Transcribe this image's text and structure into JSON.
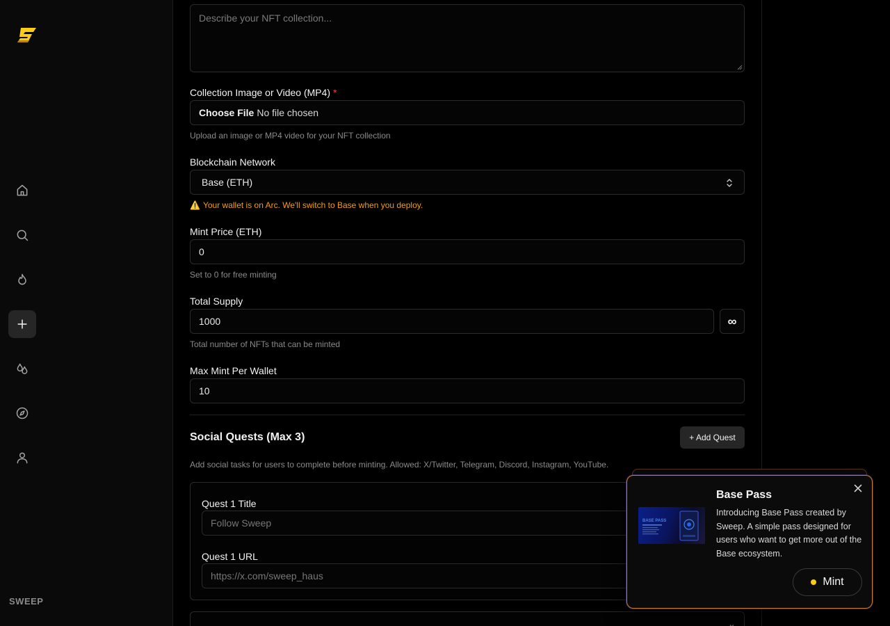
{
  "brand": {
    "name": "SWEEP",
    "accent": "#facc15"
  },
  "sidebar": {
    "items": [
      {
        "icon": "home-icon",
        "active": false
      },
      {
        "icon": "search-icon",
        "active": false
      },
      {
        "icon": "flame-icon",
        "active": false
      },
      {
        "icon": "plus-icon",
        "active": true
      },
      {
        "icon": "drops-icon",
        "active": false
      },
      {
        "icon": "compass-icon",
        "active": false
      },
      {
        "icon": "user-icon",
        "active": false
      }
    ]
  },
  "form": {
    "description": {
      "placeholder": "Describe your NFT collection..."
    },
    "media": {
      "label": "Collection Image or Video (MP4)",
      "required_mark": "*",
      "choose_label": "Choose File",
      "status": "No file chosen",
      "hint": "Upload an image or MP4 video for your NFT collection"
    },
    "network": {
      "label": "Blockchain Network",
      "value": "Base (ETH)",
      "warning_icon": "⚠️",
      "warning": "Your wallet is on Arc. We'll switch to Base when you deploy.",
      "warning_color": "#f59e0b"
    },
    "price": {
      "label": "Mint Price (ETH)",
      "value": "0",
      "hint": "Set to 0 for free minting"
    },
    "supply": {
      "label": "Total Supply",
      "value": "1000",
      "infinite_symbol": "∞",
      "hint": "Total number of NFTs that can be minted"
    },
    "max_per_wallet": {
      "label": "Max Mint Per Wallet",
      "value": "10"
    }
  },
  "quests": {
    "title": "Social Quests (Max 3)",
    "add_label": "+ Add Quest",
    "description": "Add social tasks for users to complete before minting. Allowed: X/Twitter, Telegram, Discord, Instagram, YouTube.",
    "items": [
      {
        "title_label": "Quest 1 Title",
        "title_placeholder": "Follow Sweep",
        "url_label": "Quest 1 URL",
        "url_placeholder": "https://x.com/sweep_haus"
      }
    ],
    "next_card_close": "×"
  },
  "popup": {
    "title": "Base Pass",
    "description": "Introducing Base Pass created by Sweep. A simple pass designed for users who want to get more out of the Base ecosystem.",
    "image_text": "BASE PASS",
    "button_label": "Mint",
    "border_color": "#c77a2a"
  }
}
